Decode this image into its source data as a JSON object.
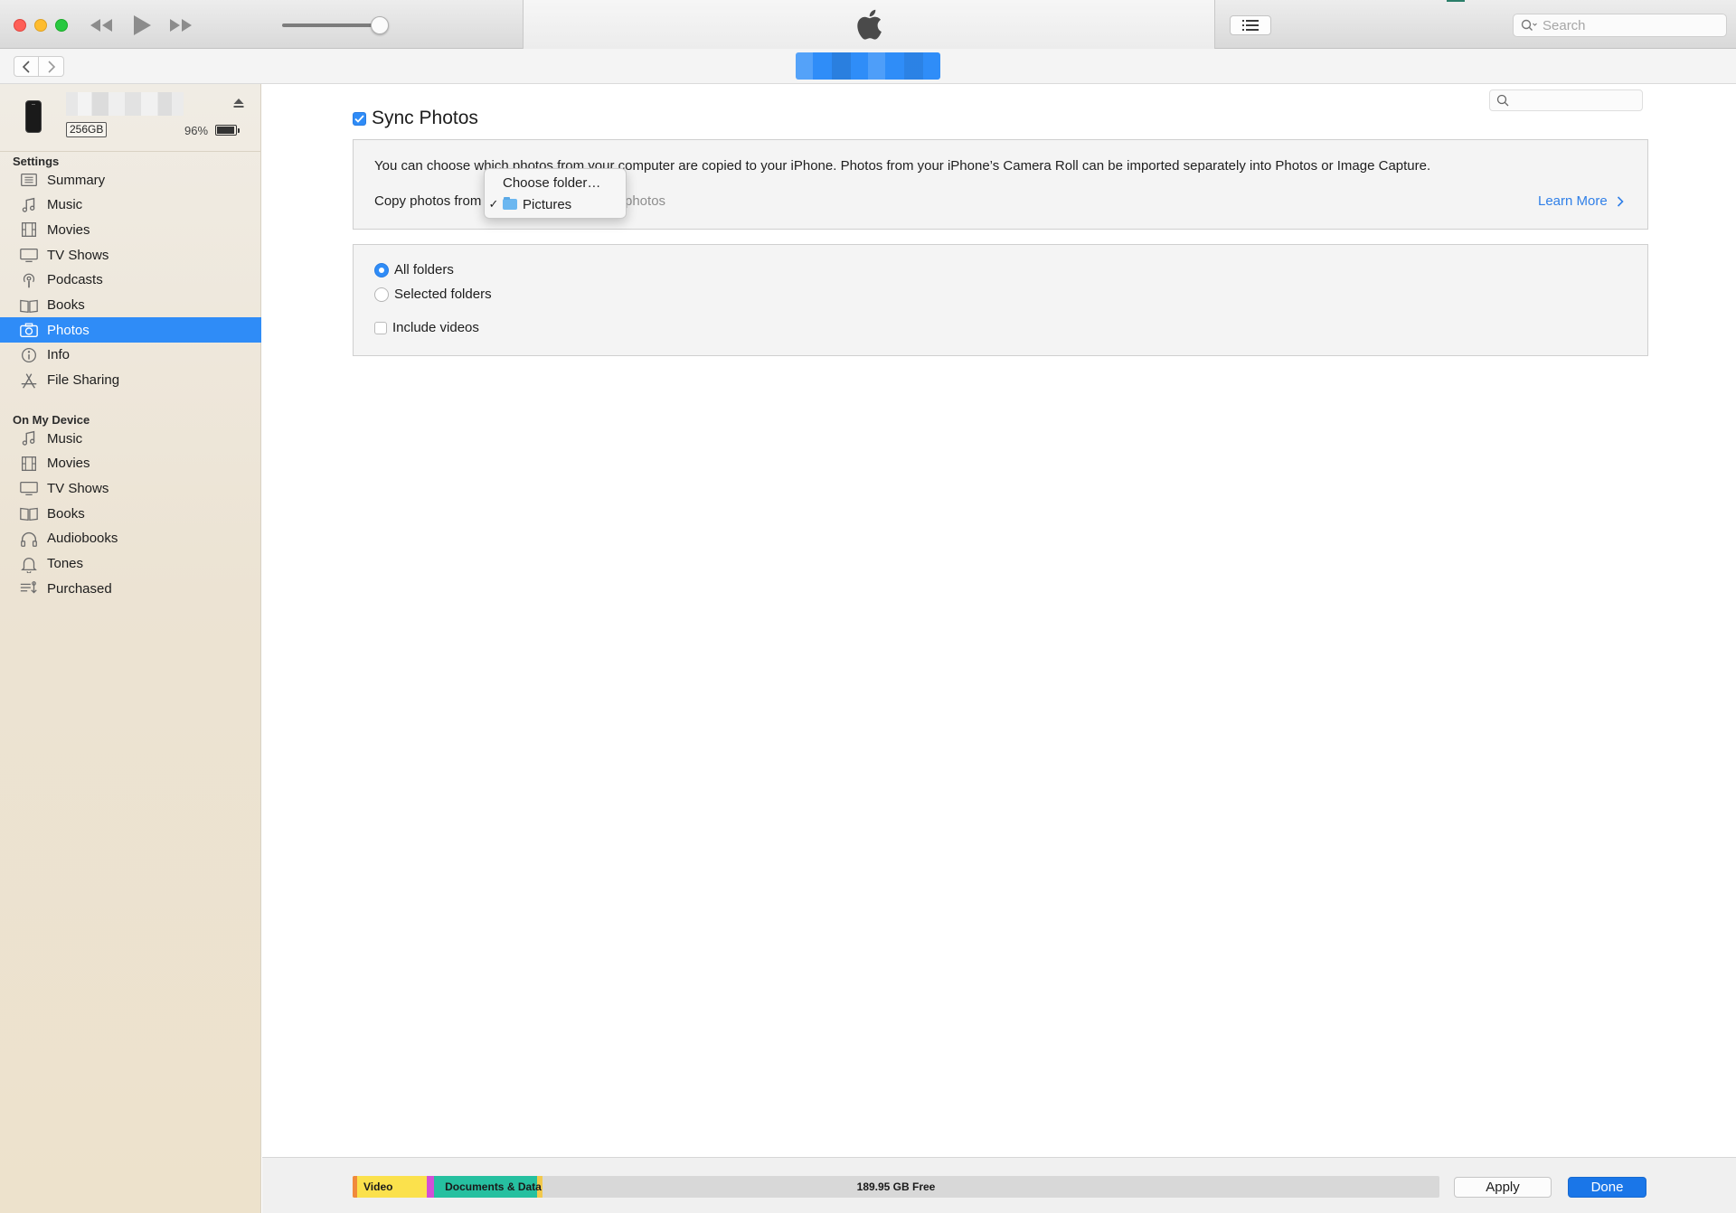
{
  "window": {
    "search_placeholder": "Search"
  },
  "device": {
    "capacity": "256GB",
    "battery": "96%",
    "battery_level": 0.96
  },
  "sidebar": {
    "settings_title": "Settings",
    "settings_items": [
      {
        "label": "Summary",
        "icon": "summary-icon"
      },
      {
        "label": "Music",
        "icon": "music-note-icon"
      },
      {
        "label": "Movies",
        "icon": "film-icon"
      },
      {
        "label": "TV Shows",
        "icon": "tv-icon"
      },
      {
        "label": "Podcasts",
        "icon": "podcast-icon"
      },
      {
        "label": "Books",
        "icon": "book-icon"
      },
      {
        "label": "Photos",
        "icon": "camera-icon",
        "active": true
      },
      {
        "label": "Info",
        "icon": "info-icon"
      },
      {
        "label": "File Sharing",
        "icon": "app-store-icon"
      }
    ],
    "device_title": "On My Device",
    "device_items": [
      {
        "label": "Music",
        "icon": "music-note-icon"
      },
      {
        "label": "Movies",
        "icon": "film-icon"
      },
      {
        "label": "TV Shows",
        "icon": "tv-icon"
      },
      {
        "label": "Books",
        "icon": "book-icon"
      },
      {
        "label": "Audiobooks",
        "icon": "headphones-icon"
      },
      {
        "label": "Tones",
        "icon": "bell-icon"
      },
      {
        "label": "Purchased",
        "icon": "purchased-icon"
      }
    ]
  },
  "photos": {
    "sync_label": "Sync Photos",
    "sync_checked": true,
    "description": "You can choose which photos from your computer are copied to your iPhone. Photos from your iPhone’s Camera Roll can be imported separately into Photos or Image Capture.",
    "copy_from_label": "Copy photos from",
    "copy_hint": "photos",
    "learn_more": "Learn More",
    "popup": {
      "choose_folder": "Choose folder…",
      "selected_folder": "Pictures",
      "check_mark": "✓"
    },
    "options": {
      "all_folders": "All folders",
      "selected_folders": "Selected folders",
      "include_videos": "Include videos",
      "selected": "all_folders"
    }
  },
  "storage": {
    "segments": [
      {
        "label": "Video",
        "color": "#fbe14c",
        "start": 0.0,
        "end": 0.068
      },
      {
        "label": "",
        "color": "#d24fd6",
        "start": 0.068,
        "end": 0.075
      },
      {
        "label": "Documents & Data",
        "color": "#26c0a0",
        "start": 0.075,
        "end": 0.17
      },
      {
        "label": "",
        "color": "#f2c94c",
        "start": 0.17,
        "end": 0.175
      }
    ],
    "free_label": "189.95 GB Free"
  },
  "buttons": {
    "apply": "Apply",
    "done": "Done"
  },
  "colors": {
    "accent": "#2f8cf7",
    "done_button": "#1a76e8",
    "link": "#2f7fe8"
  }
}
